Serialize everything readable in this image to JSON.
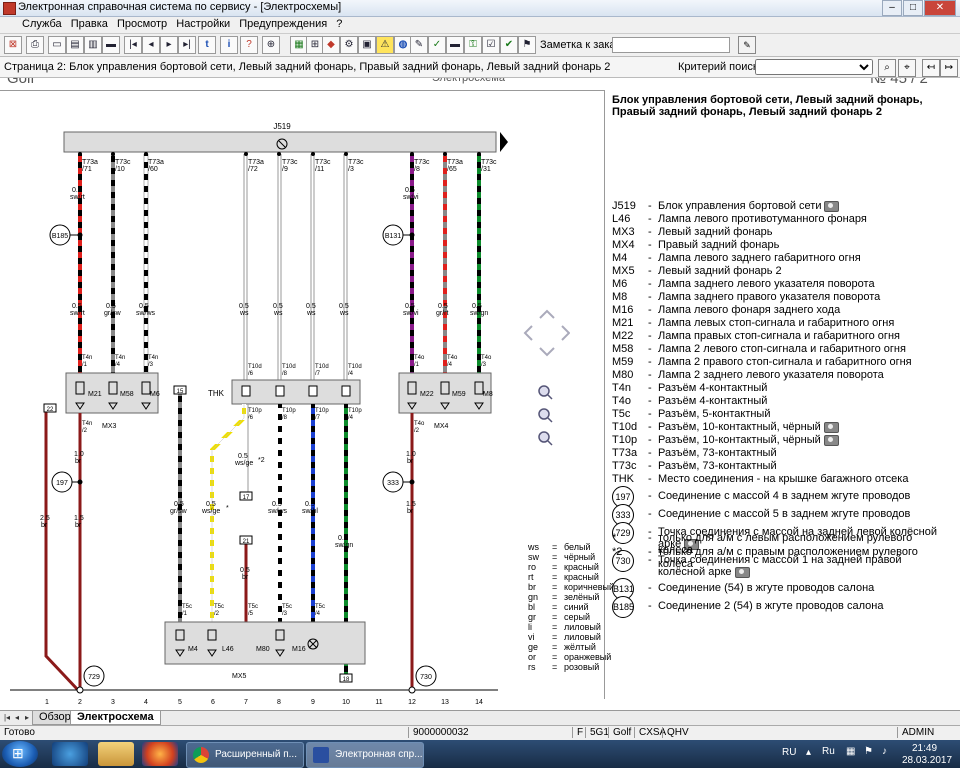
{
  "window": {
    "title": "Электронная справочная система по сервису - [Электросхемы]",
    "min": "–",
    "max": "□",
    "close": "✕"
  },
  "menu": [
    "Служба",
    "Правка",
    "Просмотр",
    "Настройки",
    "Предупреждения",
    "?"
  ],
  "toolbar": {
    "note_label": "Заметка к заказу:",
    "note_value": ""
  },
  "pagebar": {
    "title": "Страница 2: Блок управления бортовой сети, Левый задний фонарь, Правый задний фонарь, Левый задний фонарь 2",
    "search_label": "Критерий поиска:",
    "search_value": ""
  },
  "doc": {
    "model": "Golf",
    "type": "Электросхема",
    "page": "№ 45 / 2"
  },
  "legend": {
    "title": "Блок управления бортовой сети, Левый задний фонарь, Правый задний фонарь, Левый задний фонарь 2",
    "items": [
      {
        "code": "J519",
        "desc": "Блок управления бортовой сети"
      },
      {
        "code": "L46",
        "desc": "Лампа левого противотуманного фонаря"
      },
      {
        "code": "MX3",
        "desc": "Левый задний фонарь"
      },
      {
        "code": "MX4",
        "desc": "Правый задний фонарь"
      },
      {
        "code": "M4",
        "desc": "Лампа левого заднего габаритного огня"
      },
      {
        "code": "MX5",
        "desc": "Левый задний фонарь 2"
      },
      {
        "code": "M6",
        "desc": "Лампа заднего левого указателя поворота"
      },
      {
        "code": "M8",
        "desc": "Лампа заднего правого указателя поворота"
      },
      {
        "code": "M16",
        "desc": "Лампа левого фонаря заднего хода"
      },
      {
        "code": "M21",
        "desc": "Лампа левых стоп-сигнала и габаритного огня"
      },
      {
        "code": "M22",
        "desc": "Лампа правых стоп-сигнала и габаритного огня"
      },
      {
        "code": "M58",
        "desc": "Лампа 2 левого стоп-сигнала и габаритного огня"
      },
      {
        "code": "M59",
        "desc": "Лампа 2 правого стоп-сигнала и габаритного огня"
      },
      {
        "code": "M80",
        "desc": "Лампа 2 заднего левого указателя поворота"
      },
      {
        "code": "T4n",
        "desc": "Разъём 4-контактный"
      },
      {
        "code": "T4o",
        "desc": "Разъём 4-контактный"
      },
      {
        "code": "T5c",
        "desc": "Разъём, 5-контактный"
      },
      {
        "code": "T10d",
        "desc": "Разъём, 10-контактный, чёрный"
      },
      {
        "code": "T10p",
        "desc": "Разъём, 10-контактный, чёрный"
      },
      {
        "code": "T73a",
        "desc": "Разъём, 73-контактный"
      },
      {
        "code": "T73c",
        "desc": "Разъём, 73-контактный"
      },
      {
        "code": "THK",
        "desc": "Место соединения - на крышке багажного отсека"
      }
    ],
    "circles": [
      {
        "code": "197",
        "desc": "Соединение с массой 4 в заднем жгуте проводов"
      },
      {
        "code": "333",
        "desc": "Соединение с массой 5 в заднем жгуте проводов"
      },
      {
        "code": "729",
        "desc": "Точка соединения с массой на задней левой колёсной арке"
      },
      {
        "code": "730",
        "desc": "Точка соединения с массой 1 на задней правой колёсной арке"
      },
      {
        "code": "B131",
        "desc": "Соединение (54) в жгуте проводов салона"
      },
      {
        "code": "B185",
        "desc": "Соединение 2 (54) в жгуте проводов салона"
      }
    ],
    "notes": [
      {
        "code": "*",
        "desc": "только для а/м с левым расположением рулевого колеса"
      },
      {
        "code": "*2",
        "desc": "только для а/м с правым расположением рулевого колеса"
      }
    ]
  },
  "colors": [
    {
      "k": "ws",
      "v": "белый"
    },
    {
      "k": "sw",
      "v": "чёрный"
    },
    {
      "k": "ro",
      "v": "красный"
    },
    {
      "k": "rt",
      "v": "красный"
    },
    {
      "k": "br",
      "v": "коричневый"
    },
    {
      "k": "gn",
      "v": "зелёный"
    },
    {
      "k": "bl",
      "v": "синий"
    },
    {
      "k": "gr",
      "v": "серый"
    },
    {
      "k": "li",
      "v": "лиловый"
    },
    {
      "k": "vi",
      "v": "лиловый"
    },
    {
      "k": "ge",
      "v": "жёлтый"
    },
    {
      "k": "or",
      "v": "оранжевый"
    },
    {
      "k": "rs",
      "v": "розовый"
    }
  ],
  "diagram": {
    "j519": "J519",
    "thk": "THK",
    "mx3": "MX3",
    "mx4": "MX4",
    "mx5": "MX5",
    "b185": "B185",
    "b131": "B131",
    "g197": "197",
    "g333": "333",
    "g729": "729",
    "g730": "730",
    "ref15": "15",
    "ref17": "17",
    "ref18": "18",
    "ref21": "21",
    "ref22": "22",
    "star": "*",
    "star2": "*2",
    "m21": "M21",
    "m58": "M58",
    "m6": "M6",
    "m22": "M22",
    "m59": "M59",
    "m8": "M8",
    "m4": "M4",
    "l46": "L46",
    "m80": "M80",
    "m16": "M16",
    "col_numbers": [
      "1",
      "2",
      "3",
      "4",
      "5",
      "6",
      "7",
      "8",
      "9",
      "10",
      "11",
      "12",
      "13",
      "14"
    ],
    "top_pins": [
      {
        "c": "T73a",
        "n": "/71"
      },
      {
        "c": "T73c",
        "n": "/10"
      },
      {
        "c": "T73a",
        "n": "/60"
      },
      {
        "c": "T73a",
        "n": "/72"
      },
      {
        "c": "T73c",
        "n": "/9"
      },
      {
        "c": "T73c",
        "n": "/11"
      },
      {
        "c": "T73c",
        "n": "/3"
      },
      {
        "c": "T73c",
        "n": "/8"
      },
      {
        "c": "T73a",
        "n": "/65"
      },
      {
        "c": "T73c",
        "n": "/31"
      }
    ],
    "w1": [
      "0.5",
      "sw/rt"
    ],
    "w2": [
      "0.5",
      "sw/rt"
    ],
    "w3": [
      "0.5",
      "gr/sw"
    ],
    "w4": [
      "0.5",
      "sw/ws"
    ],
    "w5": [
      "0.5",
      "ws"
    ],
    "w6": [
      "0.5",
      "ws"
    ],
    "w7": [
      "0.5",
      "ws"
    ],
    "w8": [
      "0.5",
      "ws"
    ],
    "w9": [
      "0.5",
      "sw/vi"
    ],
    "w10": [
      "0.5",
      "sw/vi"
    ],
    "w11": [
      "0.5",
      "gr/rt"
    ],
    "w12": [
      "0.5",
      "sw/gn"
    ],
    "w13": [
      "1.0",
      "br"
    ],
    "w14": [
      "1.5",
      "br"
    ],
    "w15": [
      "2.5",
      "br"
    ],
    "w16": [
      "1.0",
      "br"
    ],
    "w17": [
      "1.5",
      "br"
    ],
    "w18": [
      "0.5",
      "gr/sw"
    ],
    "w19": [
      "0.5",
      "ws/ge"
    ],
    "w20": [
      "0.5",
      "ws/ge"
    ],
    "w21": [
      "0.5",
      "br"
    ],
    "w22": [
      "0.5",
      "sw/ws"
    ],
    "w23": [
      "0.5",
      "sw/bl"
    ],
    "w24": [
      "0.5",
      "sw/gn"
    ],
    "t4n": [
      "T4n",
      "/1",
      "T4n",
      "/4",
      "T4n",
      "/3",
      "T4n",
      "/2"
    ],
    "t4o": [
      "T4o",
      "/1",
      "T4o",
      "/4",
      "T4o",
      "/3",
      "T4o",
      "/2"
    ],
    "t10d": [
      "T10d",
      "/6",
      "T10d",
      "/8",
      "T10d",
      "/7",
      "T10d",
      "/4"
    ],
    "t10p": [
      "T10p",
      "/6",
      "T10p",
      "/8",
      "T10p",
      "/7",
      "T10p",
      "/4"
    ],
    "t5c": [
      "T5c",
      "/1",
      "T5c",
      "/2",
      "T5c",
      "/5",
      "T5c",
      "/3",
      "T5c",
      "/4"
    ]
  },
  "tabs": {
    "overview": "Обзор",
    "active": "Электросхема"
  },
  "status": {
    "ready": "Готово",
    "code": "9000000032",
    "f": "F",
    "sg": "5G1",
    "model": "Golf",
    "eng": "CXSA",
    "gear": "QHV",
    "user": "ADMIN"
  },
  "taskbar": {
    "task1": "Расширенный п...",
    "task2": "Электронная спр...",
    "lang": "RU",
    "time": "21:49",
    "date": "28.03.2017"
  }
}
